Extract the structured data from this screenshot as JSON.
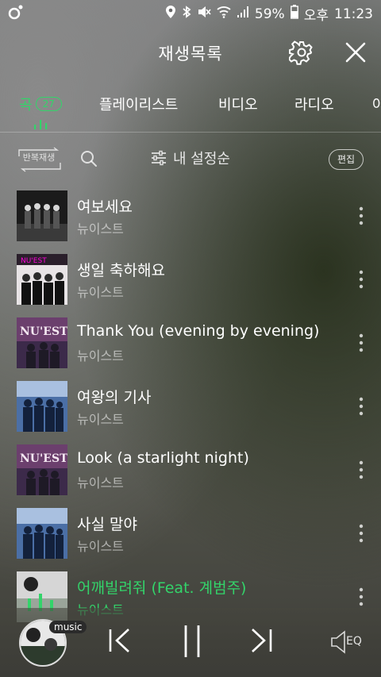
{
  "status": {
    "battery": "59%",
    "ampm": "오후",
    "time": "11:23"
  },
  "header": {
    "title": "재생목록"
  },
  "tabs": [
    {
      "label": "곡",
      "count": "27"
    },
    {
      "label": "플레이리스트"
    },
    {
      "label": "비디오"
    },
    {
      "label": "라디오"
    },
    {
      "label": "아"
    }
  ],
  "toolbar": {
    "repeat_label": "반복재생",
    "sort_label": "내 설정순",
    "edit_label": "편집"
  },
  "songs": [
    {
      "title": "여보세요",
      "artist": "뉴이스트"
    },
    {
      "title": "생일 축하해요",
      "artist": "뉴이스트"
    },
    {
      "title": "Thank You (evening by evening)",
      "artist": "뉴이스트"
    },
    {
      "title": "여왕의 기사",
      "artist": "뉴이스트"
    },
    {
      "title": "Look (a starlight night)",
      "artist": "뉴이스트"
    },
    {
      "title": "사실 말야",
      "artist": "뉴이스트"
    },
    {
      "title": "어깨빌려줘 (Feat. 계범주)",
      "artist": "뉴이스트"
    }
  ],
  "player": {
    "tag": "music",
    "eq_label": "EQ"
  },
  "colors": {
    "accent": "#33d46a"
  }
}
